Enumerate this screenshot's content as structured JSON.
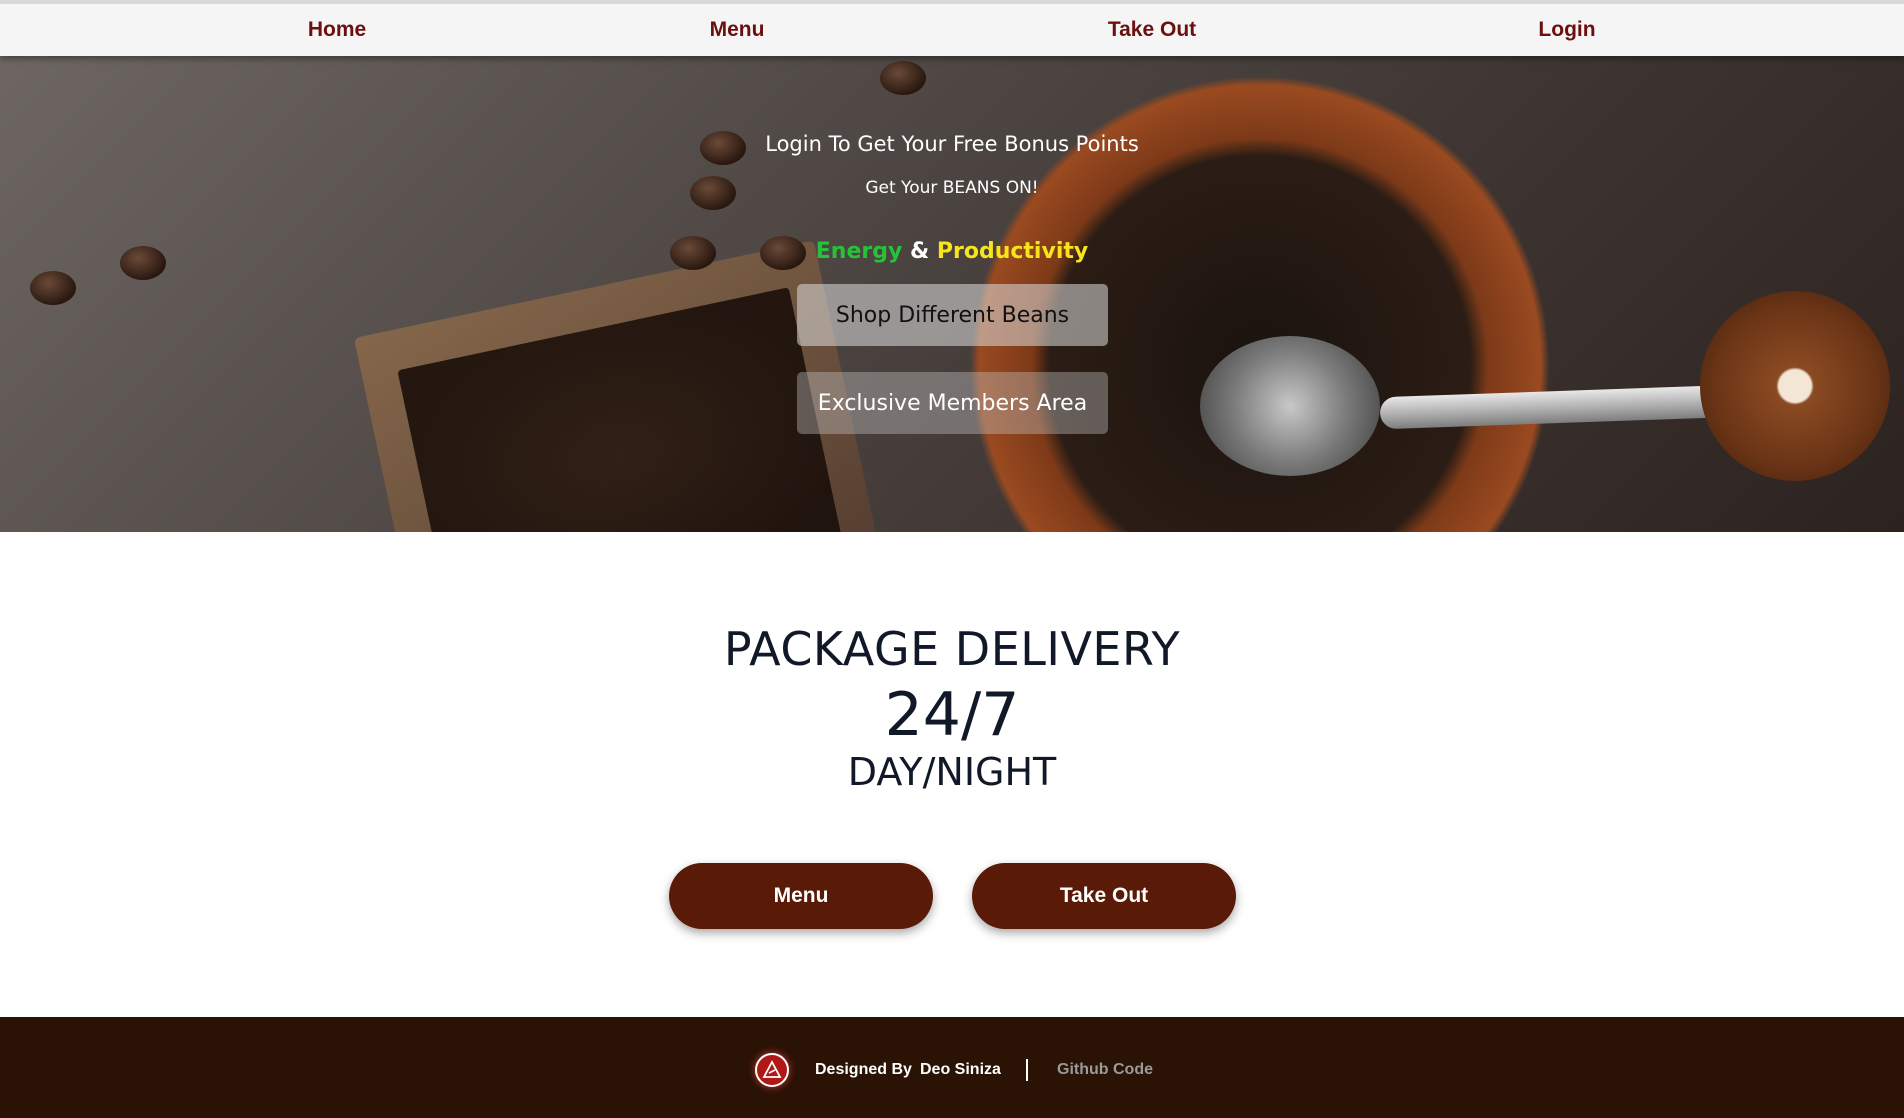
{
  "nav": {
    "items": [
      {
        "label": "Home"
      },
      {
        "label": "Menu"
      },
      {
        "label": "Take Out"
      },
      {
        "label": "Login"
      }
    ]
  },
  "hero": {
    "line1": "Login To Get Your Free Bonus Points",
    "line2": "Get Your BEANS ON!",
    "tagline": {
      "energy": "Energy",
      "amp": "&",
      "productivity": "Productivity"
    },
    "shop_button": "Shop Different Beans",
    "members_button": "Exclusive Members Area"
  },
  "delivery": {
    "title": "PACKAGE DELIVERY",
    "hours": "24/7",
    "sub": "DAY/NIGHT",
    "menu_button": "Menu",
    "takeout_button": "Take Out"
  },
  "footer": {
    "designed_by": "Designed By",
    "name": "Deo Siniza",
    "github": "Github Code"
  },
  "colors": {
    "brand": "#5a1a08",
    "nav_text": "#6b0f0f",
    "footer_bg": "#2a1205",
    "energy": "#27c23a",
    "productivity": "#f7e41a"
  },
  "icons": {
    "footer_logo": "triangle-logo-icon"
  }
}
